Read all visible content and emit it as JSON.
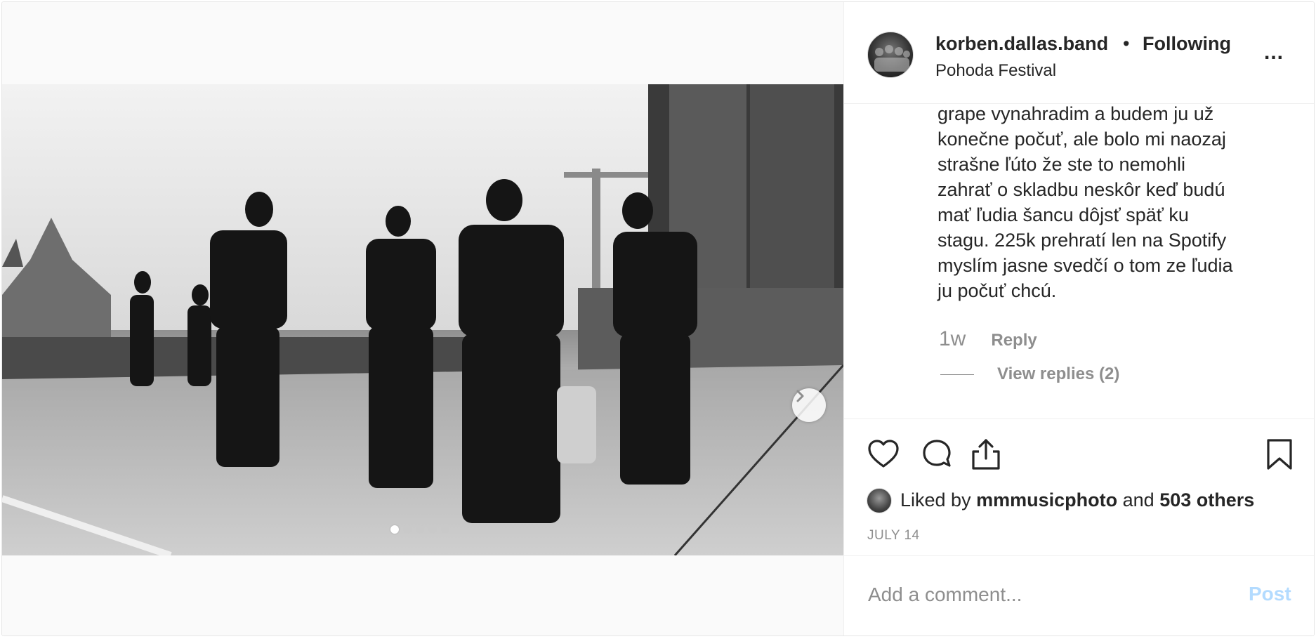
{
  "post": {
    "username": "korben.dallas.band",
    "separator": "•",
    "follow_status": "Following",
    "location": "Pohoda Festival",
    "more_label": "...",
    "image_alt_icon": "photo-black-and-white-band-walking",
    "carousel": {
      "total": 5,
      "active_index": 0
    }
  },
  "comment": {
    "lines": [
      "grape vynahradim a budem ju už",
      "konečne počuť, ale bolo mi naozaj",
      "strašne ľúto že ste to nemohli",
      "zahrať o skladbu neskôr keď budú",
      "mať ľudia šancu dôjsť späť ku",
      "stagu. 225k prehratí len na Spotify",
      "myslím jasne svedčí o tom ze ľudia",
      "ju počuť chcú."
    ],
    "time": "1w",
    "reply_label": "Reply",
    "view_replies_label": "View replies (2)"
  },
  "actions": {
    "icons": [
      "heart-icon",
      "comment-icon",
      "share-icon",
      "bookmark-icon"
    ]
  },
  "likes": {
    "prefix": "Liked by",
    "user": "mmmusicphoto",
    "middle": "and",
    "others": "503 others"
  },
  "date": "JULY 14",
  "add_comment": {
    "placeholder": "Add a comment...",
    "post_label": "Post"
  },
  "colors": {
    "text": "#262626",
    "secondary": "#8e8e8e",
    "post_disabled": "#b3dbff",
    "border": "#efefef"
  }
}
